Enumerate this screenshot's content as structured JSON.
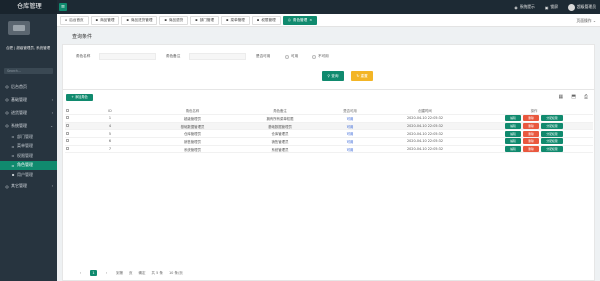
{
  "app": {
    "title": "仓库管理"
  },
  "header": {
    "notify": "系统提示",
    "lock": "锁屏",
    "user": "超级管理员"
  },
  "sidebar": {
    "user_name": "合肥 | 超级管理员, 系统管理",
    "search_placeholder": "Search...",
    "items": [
      {
        "label": "后台首页",
        "icon": "dashboard-icon"
      },
      {
        "label": "基础管理",
        "icon": "folder-icon"
      },
      {
        "label": "进货管理",
        "icon": "inbound-icon"
      },
      {
        "label": "系统管理",
        "icon": "settings-icon"
      },
      {
        "label": "部门管理",
        "icon": "dept-icon"
      },
      {
        "label": "菜单管理",
        "icon": "menu-icon"
      },
      {
        "label": "权限管理",
        "icon": "permission-icon"
      },
      {
        "label": "角色管理",
        "icon": "role-icon"
      },
      {
        "label": "用户管理",
        "icon": "user-icon"
      },
      {
        "label": "其它管理",
        "icon": "folder-icon"
      }
    ]
  },
  "tabs": [
    {
      "label": "后台首页",
      "active": false
    },
    {
      "label": "商品管理",
      "active": false
    },
    {
      "label": "商品进货管理",
      "active": false
    },
    {
      "label": "商品退货",
      "active": false
    },
    {
      "label": "部门管理",
      "active": false
    },
    {
      "label": "菜单管理",
      "active": false
    },
    {
      "label": "权限管理",
      "active": false
    },
    {
      "label": "角色管理",
      "active": true
    }
  ],
  "tabs_right": "页面操作",
  "query": {
    "title": "查询条件",
    "role_name_label": "角色名称",
    "role_remark_label": "角色备注",
    "available_label": "是否可用",
    "option_yes": "可用",
    "option_no": "不可用",
    "btn_query": "查询",
    "btn_reset": "重置"
  },
  "list": {
    "add_button": "添加角色",
    "columns": [
      "ID",
      "角色名称",
      "角色备注",
      "是否可用",
      "创建时间",
      "操作"
    ],
    "actions": {
      "edit": "编辑",
      "delete": "删除",
      "assign": "分配权限"
    },
    "rows": [
      {
        "id": "1",
        "name": "超级管理员",
        "remark": "拥有所有菜单权限",
        "available": "可用",
        "time": "2020-04-10 22:05:32"
      },
      {
        "id": "4",
        "name": "基础数据管理员",
        "remark": "基础数据管理员",
        "available": "可用",
        "time": "2020-04-10 22:05:32"
      },
      {
        "id": "5",
        "name": "仓库管理员",
        "remark": "仓库管理员",
        "available": "可用",
        "time": "2020-04-10 22:05:32"
      },
      {
        "id": "6",
        "name": "销售管理员",
        "remark": "销售管理员",
        "available": "可用",
        "time": "2020-04-10 22:05:32"
      },
      {
        "id": "7",
        "name": "系统管理员",
        "remark": "系统管理员",
        "available": "可用",
        "time": "2020-04-10 22:05:32"
      }
    ]
  },
  "pager": {
    "current": "1",
    "goto": "到第",
    "page": "页",
    "confirm": "确定",
    "total": "共 5 条",
    "per_page": "10 条/页"
  },
  "colors": {
    "accent": "#108a6e",
    "delete": "#e9583e",
    "reset": "#f3b526",
    "sidebar": "#27343f"
  }
}
